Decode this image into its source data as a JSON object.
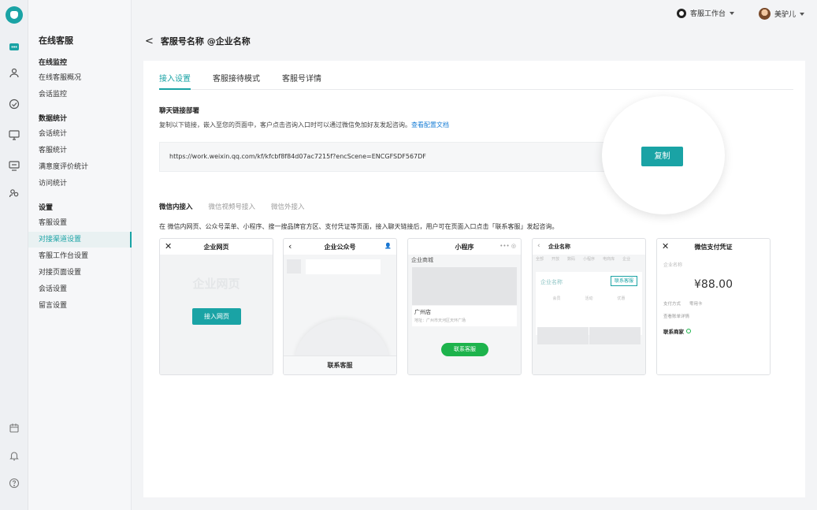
{
  "rail": {
    "icons": [
      "logo-icon",
      "chat-icon",
      "user-tree-icon",
      "gauge-icon",
      "monitor-chat-icon",
      "monitor-icon",
      "people-icon",
      "calendar-icon",
      "bell-icon",
      "help-icon"
    ]
  },
  "sidebar": {
    "title": "在线客服",
    "groups": [
      {
        "label": "在线监控",
        "items": [
          "在线客服概况",
          "会话监控"
        ]
      },
      {
        "label": "数据统计",
        "items": [
          "会话统计",
          "客服统计",
          "满意度评价统计",
          "访问统计"
        ]
      },
      {
        "label": "设置",
        "items": [
          "客服设置",
          "对接渠道设置",
          "客服工作台设置",
          "对接页面设置",
          "会话设置",
          "留言设置"
        ]
      }
    ],
    "active": "对接渠道设置"
  },
  "topbar": {
    "workbench": "客服工作台",
    "user": "美驴儿"
  },
  "header": {
    "back": "<",
    "title": "客服号名称 @企业名称"
  },
  "tabs": [
    "接入设置",
    "客服接待模式",
    "客服号详情"
  ],
  "link_section": {
    "title": "聊天链接部署",
    "desc": "复制以下链接，嵌入至您的页面中，客户点击咨询入口时可以通过微信免加好友发起咨询。",
    "doc_link": "查看配置文档",
    "url": "https://work.weixin.qq.com/kf/kfcbf8f84d07ac7215f?encScene=ENCGFSDF567DF",
    "copy": "复制"
  },
  "subtabs": [
    "微信内接入",
    "微信视频号接入",
    "微信外接入"
  ],
  "subtab_desc": "在 微信内网页、公众号菜单、小程序、搜一搜品牌官方区、支付凭证等页面，接入聊天链接后，用户可在页面入口点击「联系客服」发起咨询。",
  "previews": {
    "web": {
      "title": "企业网页",
      "ghost": "企业网页",
      "button": "接入网页"
    },
    "oa": {
      "title": "企业公众号",
      "bottom": "联系客服"
    },
    "mp": {
      "title": "小程序",
      "shop": "企业商城",
      "store": "广州店",
      "addr": "地址：广州市天河区天环广场",
      "button": "联系客服"
    },
    "ent": {
      "title": "企业名称",
      "tabs": [
        "全部",
        "开放",
        "数码",
        "小程序",
        "电商库",
        "企业"
      ],
      "name": "企业名称",
      "button": "联系客服",
      "icons": [
        "会员",
        "活动",
        "优惠"
      ]
    },
    "pay": {
      "title": "微信支付凭证",
      "merchant": "企业名称",
      "amount": "¥88.00",
      "row1": "支付方式　　零用卡",
      "row2": "查看账单详情",
      "contact": "联系商家"
    }
  }
}
